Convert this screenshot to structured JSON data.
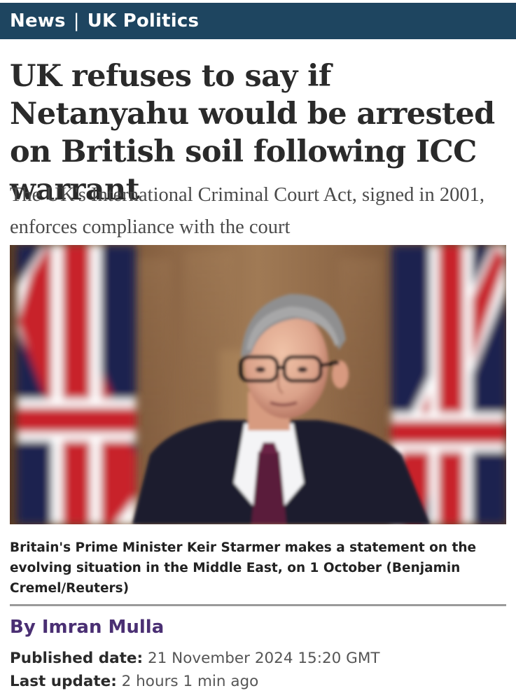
{
  "section_bar": {
    "section": "News",
    "separator": "|",
    "subsection": "UK Politics",
    "background_color": "#1e4560"
  },
  "article": {
    "headline": "UK refuses to say if Netanyahu would be arrested on British soil following ICC warrant",
    "standfirst": "The UK's International Criminal Court Act, signed in 2001, enforces compliance with the court",
    "image": {
      "subject": "man in dark suit and glasses in front of Union Jack flags"
    },
    "caption": "Britain's Prime Minister Keir Starmer makes a statement on the evolving situation in the Middle East, on 1 October (Benjamin Cremel/Reuters)",
    "byline": "By Imran Mulla",
    "byline_color": "#4a2f73",
    "published_label": "Published date:",
    "published_value": "21 November 2024 15:20 GMT",
    "updated_label": "Last update:",
    "updated_value": "2 hours 1 min ago"
  }
}
